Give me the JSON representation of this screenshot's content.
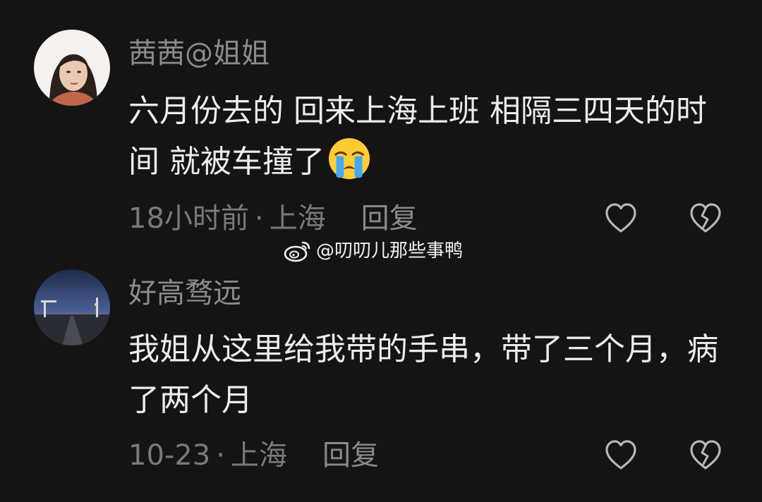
{
  "comments": [
    {
      "username": "茜茜@姐姐",
      "text": "六月份去的 回来上海上班 相隔三四天的时间 就被车撞了",
      "emoji": "loudly-crying-face",
      "time": "18小时前",
      "separator": "·",
      "location": "上海",
      "reply_label": "回复",
      "like_icon": "heart-outline-icon",
      "dislike_icon": "broken-heart-icon"
    },
    {
      "username": "好高骛远",
      "text": "我姐从这里给我带的手串，带了三个月，病了两个月",
      "time": "10-23",
      "separator": "·",
      "location": "上海",
      "reply_label": "回复",
      "like_icon": "heart-outline-icon",
      "dislike_icon": "broken-heart-icon"
    }
  ],
  "watermark": {
    "icon": "weibo-logo-icon",
    "text": "@叨叨儿那些事鸭"
  },
  "colors": {
    "background": "#141414",
    "username": "#8c8c8c",
    "body_text": "#ececec",
    "meta_text": "#7a7a7a",
    "icon_stroke": "#b8b8b8"
  }
}
